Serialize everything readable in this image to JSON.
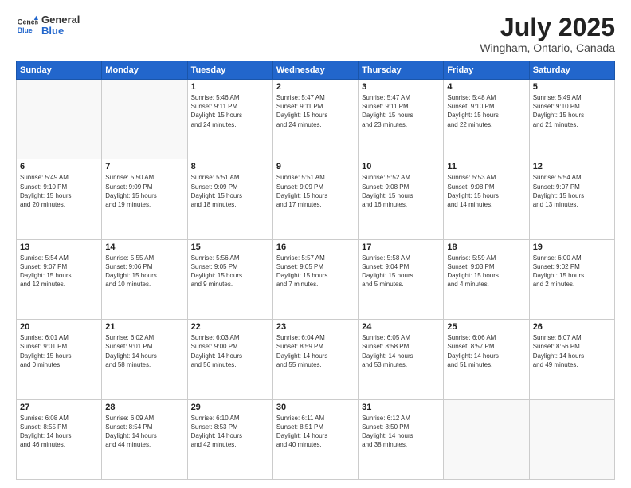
{
  "header": {
    "logo": {
      "general": "General",
      "blue": "Blue"
    },
    "title": "July 2025",
    "location": "Wingham, Ontario, Canada"
  },
  "weekdays": [
    "Sunday",
    "Monday",
    "Tuesday",
    "Wednesday",
    "Thursday",
    "Friday",
    "Saturday"
  ],
  "weeks": [
    [
      {
        "day": "",
        "empty": true
      },
      {
        "day": "",
        "empty": true
      },
      {
        "day": "1",
        "sunrise": "5:46 AM",
        "sunset": "9:11 PM",
        "daylight": "15 hours and 24 minutes."
      },
      {
        "day": "2",
        "sunrise": "5:47 AM",
        "sunset": "9:11 PM",
        "daylight": "15 hours and 24 minutes."
      },
      {
        "day": "3",
        "sunrise": "5:47 AM",
        "sunset": "9:11 PM",
        "daylight": "15 hours and 23 minutes."
      },
      {
        "day": "4",
        "sunrise": "5:48 AM",
        "sunset": "9:10 PM",
        "daylight": "15 hours and 22 minutes."
      },
      {
        "day": "5",
        "sunrise": "5:49 AM",
        "sunset": "9:10 PM",
        "daylight": "15 hours and 21 minutes."
      }
    ],
    [
      {
        "day": "6",
        "sunrise": "5:49 AM",
        "sunset": "9:10 PM",
        "daylight": "15 hours and 20 minutes."
      },
      {
        "day": "7",
        "sunrise": "5:50 AM",
        "sunset": "9:09 PM",
        "daylight": "15 hours and 19 minutes."
      },
      {
        "day": "8",
        "sunrise": "5:51 AM",
        "sunset": "9:09 PM",
        "daylight": "15 hours and 18 minutes."
      },
      {
        "day": "9",
        "sunrise": "5:51 AM",
        "sunset": "9:09 PM",
        "daylight": "15 hours and 17 minutes."
      },
      {
        "day": "10",
        "sunrise": "5:52 AM",
        "sunset": "9:08 PM",
        "daylight": "15 hours and 16 minutes."
      },
      {
        "day": "11",
        "sunrise": "5:53 AM",
        "sunset": "9:08 PM",
        "daylight": "15 hours and 14 minutes."
      },
      {
        "day": "12",
        "sunrise": "5:54 AM",
        "sunset": "9:07 PM",
        "daylight": "15 hours and 13 minutes."
      }
    ],
    [
      {
        "day": "13",
        "sunrise": "5:54 AM",
        "sunset": "9:07 PM",
        "daylight": "15 hours and 12 minutes."
      },
      {
        "day": "14",
        "sunrise": "5:55 AM",
        "sunset": "9:06 PM",
        "daylight": "15 hours and 10 minutes."
      },
      {
        "day": "15",
        "sunrise": "5:56 AM",
        "sunset": "9:05 PM",
        "daylight": "15 hours and 9 minutes."
      },
      {
        "day": "16",
        "sunrise": "5:57 AM",
        "sunset": "9:05 PM",
        "daylight": "15 hours and 7 minutes."
      },
      {
        "day": "17",
        "sunrise": "5:58 AM",
        "sunset": "9:04 PM",
        "daylight": "15 hours and 5 minutes."
      },
      {
        "day": "18",
        "sunrise": "5:59 AM",
        "sunset": "9:03 PM",
        "daylight": "15 hours and 4 minutes."
      },
      {
        "day": "19",
        "sunrise": "6:00 AM",
        "sunset": "9:02 PM",
        "daylight": "15 hours and 2 minutes."
      }
    ],
    [
      {
        "day": "20",
        "sunrise": "6:01 AM",
        "sunset": "9:01 PM",
        "daylight": "15 hours and 0 minutes."
      },
      {
        "day": "21",
        "sunrise": "6:02 AM",
        "sunset": "9:01 PM",
        "daylight": "14 hours and 58 minutes."
      },
      {
        "day": "22",
        "sunrise": "6:03 AM",
        "sunset": "9:00 PM",
        "daylight": "14 hours and 56 minutes."
      },
      {
        "day": "23",
        "sunrise": "6:04 AM",
        "sunset": "8:59 PM",
        "daylight": "14 hours and 55 minutes."
      },
      {
        "day": "24",
        "sunrise": "6:05 AM",
        "sunset": "8:58 PM",
        "daylight": "14 hours and 53 minutes."
      },
      {
        "day": "25",
        "sunrise": "6:06 AM",
        "sunset": "8:57 PM",
        "daylight": "14 hours and 51 minutes."
      },
      {
        "day": "26",
        "sunrise": "6:07 AM",
        "sunset": "8:56 PM",
        "daylight": "14 hours and 49 minutes."
      }
    ],
    [
      {
        "day": "27",
        "sunrise": "6:08 AM",
        "sunset": "8:55 PM",
        "daylight": "14 hours and 46 minutes."
      },
      {
        "day": "28",
        "sunrise": "6:09 AM",
        "sunset": "8:54 PM",
        "daylight": "14 hours and 44 minutes."
      },
      {
        "day": "29",
        "sunrise": "6:10 AM",
        "sunset": "8:53 PM",
        "daylight": "14 hours and 42 minutes."
      },
      {
        "day": "30",
        "sunrise": "6:11 AM",
        "sunset": "8:51 PM",
        "daylight": "14 hours and 40 minutes."
      },
      {
        "day": "31",
        "sunrise": "6:12 AM",
        "sunset": "8:50 PM",
        "daylight": "14 hours and 38 minutes."
      },
      {
        "day": "",
        "empty": true
      },
      {
        "day": "",
        "empty": true
      }
    ]
  ]
}
